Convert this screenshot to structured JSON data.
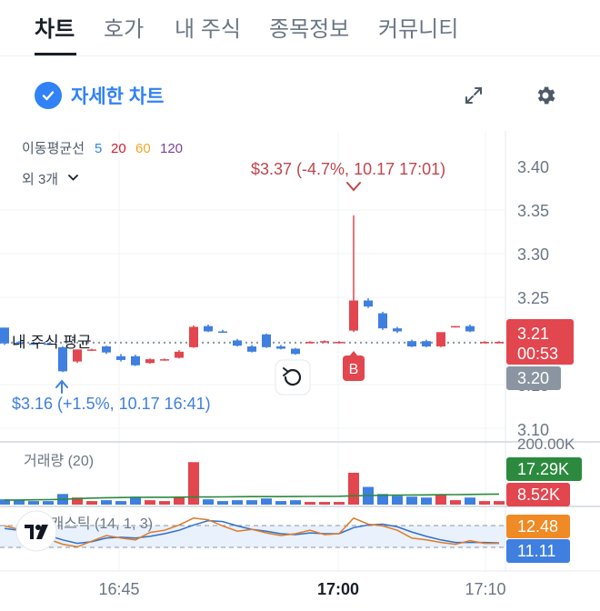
{
  "tabs": [
    {
      "label": "차트",
      "active": true
    },
    {
      "label": "호가",
      "active": false
    },
    {
      "label": "내 주식",
      "active": false
    },
    {
      "label": "종목정보",
      "active": false
    },
    {
      "label": "커뮤니티",
      "active": false
    }
  ],
  "toolbar": {
    "detail_label": "자세한 차트",
    "detail_checked": true,
    "expand_icon": "expand-icon",
    "settings_icon": "gear-icon"
  },
  "indicators": {
    "ma_label": "이동평균선",
    "ma_periods": [
      {
        "label": "5",
        "color": "#3182f6"
      },
      {
        "label": "20",
        "color": "#d22030"
      },
      {
        "label": "60",
        "color": "#f5a623"
      },
      {
        "label": "120",
        "color": "#7b3fa0"
      }
    ],
    "more_label": "외 3개"
  },
  "annotations": {
    "high_label": "$3.37 (-4.7%, 10.17 17:01)",
    "low_label": "$3.16 (+1.5%, 10.17 16:41)",
    "avg_label": "내 주식 평균",
    "buy_marker": "B"
  },
  "price_axis": {
    "ticks": [
      "3.40",
      "3.35",
      "3.30",
      "3.25",
      "3.15",
      "3.10"
    ],
    "current_price": "3.21",
    "countdown": "00:53",
    "avg_price": "3.20"
  },
  "volume": {
    "label": "거래량 (20)",
    "scale_label": "200.00K",
    "ma_badge": "17.29K",
    "current_badge": "8.52K"
  },
  "stochastic": {
    "label": "스토캐스틱 (14, 1, 3)",
    "k_badge": "12.48",
    "d_badge": "11.11"
  },
  "time_axis": {
    "ticks": [
      "16:45",
      "17:00",
      "17:10"
    ]
  },
  "colors": {
    "up": "#e2464f",
    "down": "#3f7fe0",
    "ma_green": "#2b8a3e",
    "stoch_k": "#e07a24",
    "stoch_d": "#2f6fd0",
    "avg_badge": "#8b95a1"
  },
  "chart_data": {
    "type": "candlestick",
    "price_ylim": [
      3.085,
      3.435
    ],
    "candles": [
      {
        "o": 3.221,
        "h": 3.221,
        "c": 3.2,
        "l": 3.198
      },
      {
        "o": 3.201,
        "h": 3.203,
        "c": 3.2,
        "l": 3.199
      },
      {
        "o": 3.2,
        "h": 3.201,
        "c": 3.199,
        "l": 3.198
      },
      {
        "o": 3.2,
        "h": 3.201,
        "c": 3.199,
        "l": 3.198
      },
      {
        "o": 3.195,
        "h": 3.196,
        "c": 3.163,
        "l": 3.162
      },
      {
        "o": 3.176,
        "h": 3.192,
        "c": 3.192,
        "l": 3.174
      },
      {
        "o": 3.191,
        "h": 3.193,
        "c": 3.192,
        "l": 3.19
      },
      {
        "o": 3.196,
        "h": 3.197,
        "c": 3.188,
        "l": 3.186
      },
      {
        "o": 3.183,
        "h": 3.186,
        "c": 3.178,
        "l": 3.176
      },
      {
        "o": 3.183,
        "h": 3.185,
        "c": 3.171,
        "l": 3.17
      },
      {
        "o": 3.174,
        "h": 3.18,
        "c": 3.179,
        "l": 3.173
      },
      {
        "o": 3.178,
        "h": 3.18,
        "c": 3.179,
        "l": 3.177
      },
      {
        "o": 3.181,
        "h": 3.191,
        "c": 3.189,
        "l": 3.18
      },
      {
        "o": 3.195,
        "h": 3.224,
        "c": 3.222,
        "l": 3.194
      },
      {
        "o": 3.223,
        "h": 3.225,
        "c": 3.216,
        "l": 3.215
      },
      {
        "o": 3.216,
        "h": 3.218,
        "c": 3.215,
        "l": 3.214
      },
      {
        "o": 3.204,
        "h": 3.206,
        "c": 3.197,
        "l": 3.196
      },
      {
        "o": 3.196,
        "h": 3.198,
        "c": 3.189,
        "l": 3.188
      },
      {
        "o": 3.212,
        "h": 3.213,
        "c": 3.195,
        "l": 3.194
      },
      {
        "o": 3.196,
        "h": 3.198,
        "c": 3.193,
        "l": 3.192
      },
      {
        "o": 3.193,
        "h": 3.194,
        "c": 3.186,
        "l": 3.185
      },
      {
        "o": 3.201,
        "h": 3.203,
        "c": 3.202,
        "l": 3.2
      },
      {
        "o": 3.202,
        "h": 3.204,
        "c": 3.203,
        "l": 3.201
      },
      {
        "o": 3.201,
        "h": 3.203,
        "c": 3.202,
        "l": 3.2
      },
      {
        "o": 3.217,
        "h": 3.37,
        "c": 3.257,
        "l": 3.215
      },
      {
        "o": 3.257,
        "h": 3.26,
        "c": 3.249,
        "l": 3.247
      },
      {
        "o": 3.24,
        "h": 3.242,
        "c": 3.22,
        "l": 3.218
      },
      {
        "o": 3.22,
        "h": 3.222,
        "c": 3.216,
        "l": 3.214
      },
      {
        "o": 3.203,
        "h": 3.205,
        "c": 3.196,
        "l": 3.195
      },
      {
        "o": 3.203,
        "h": 3.205,
        "c": 3.196,
        "l": 3.195
      },
      {
        "o": 3.196,
        "h": 3.214,
        "c": 3.215,
        "l": 3.195
      },
      {
        "o": 3.222,
        "h": 3.223,
        "c": 3.223,
        "l": 3.221
      },
      {
        "o": 3.223,
        "h": 3.225,
        "c": 3.216,
        "l": 3.215
      },
      {
        "o": 3.201,
        "h": 3.203,
        "c": 3.202,
        "l": 3.2
      },
      {
        "o": 3.201,
        "h": 3.203,
        "c": 3.202,
        "l": 3.2
      }
    ],
    "volume_ylim": [
      0,
      200000
    ],
    "volumes": [
      6000,
      5000,
      4000,
      4000,
      12000,
      8000,
      4000,
      5000,
      4000,
      9000,
      5000,
      4000,
      8000,
      48000,
      6000,
      4000,
      5000,
      5000,
      7000,
      4000,
      5000,
      3000,
      3000,
      3000,
      36000,
      20000,
      12000,
      10000,
      9000,
      8000,
      11000,
      5000,
      8000,
      4000,
      4000
    ],
    "volume_ma": [
      5000,
      5200,
      5400,
      5600,
      6000,
      6800,
      7400,
      7800,
      8000,
      8200,
      8300,
      8300,
      8400,
      8600,
      8600,
      8700,
      8900,
      9000,
      9000,
      9000,
      9100,
      9200,
      9300,
      9500,
      10000,
      10300,
      10600,
      10800,
      10900,
      11000,
      11200,
      11300,
      11500,
      11700,
      11900
    ],
    "stoch_ylim": [
      0,
      100
    ],
    "stoch_k": [
      70,
      62,
      55,
      40,
      28,
      22,
      35,
      48,
      42,
      38,
      55,
      60,
      72,
      88,
      84,
      70,
      58,
      62,
      54,
      48,
      52,
      60,
      50,
      52,
      88,
      74,
      70,
      60,
      42,
      38,
      32,
      28,
      36,
      30,
      30
    ],
    "stoch_d": [
      64,
      60,
      56,
      48,
      38,
      30,
      34,
      42,
      44,
      42,
      46,
      52,
      60,
      72,
      82,
      80,
      70,
      62,
      58,
      52,
      50,
      54,
      52,
      52,
      66,
      72,
      74,
      68,
      56,
      46,
      38,
      32,
      32,
      32,
      31
    ],
    "stoch_levels": [
      80,
      20
    ],
    "avg_line": 3.201
  }
}
